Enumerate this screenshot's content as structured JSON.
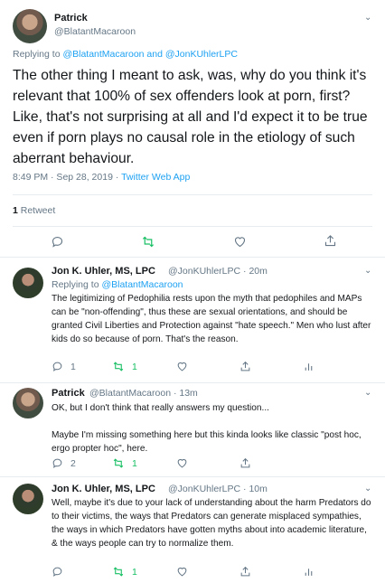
{
  "main_tweet": {
    "author_name": "Patrick",
    "author_handle": "@BlatantMacaroon",
    "reply_prefix": "Replying to ",
    "reply_handle_1": "@BlatantMacaroon",
    "reply_and": " and ",
    "reply_handle_2": "@JonKUhlerLPC",
    "text": "The other thing I meant to ask, was, why do you think it's relevant that 100% of sex offenders look at porn, first? Like, that's not surprising at all and I'd expect it to be true even if porn plays no causal role in the etiology of such aberrant behaviour.",
    "timestamp": "8:49 PM · Sep 28, 2019 · ",
    "source_app": "Twitter Web App",
    "retweet_count": "1",
    "retweet_label": " Retweet"
  },
  "replies": [
    {
      "author_name": "Jon K. Uhler, MS, LPC",
      "author_handle": "@JonKUhlerLPC · 20m",
      "reply_prefix": "Replying to ",
      "reply_handle": "@BlatantMacaroon",
      "text": "The legitimizing of Pedophilia rests upon the myth that pedophiles and MAPs can be \"non-offending\", thus these are sexual orientations, and should be granted Civil Liberties and Protection against \"hate speech.\" Men who lust after kids do so because of porn. That's the reason.",
      "reply_count": "1",
      "retweet_count": "1",
      "like_count": ""
    },
    {
      "author_name": "Patrick",
      "author_handle": "@BlatantMacaroon · 13m",
      "text": "OK, but I don't think that really answers my question...\n\nMaybe I'm missing something here but this kinda looks like classic \"post hoc, ergo propter hoc\", here.",
      "reply_count": "2",
      "retweet_count": "1",
      "like_count": ""
    },
    {
      "author_name": "Jon K. Uhler, MS, LPC",
      "author_handle": "@JonKUhlerLPC · 10m",
      "text": "Well, maybe it's due to your lack of understanding about the harm Predators do to their victims, the ways that Predators can generate misplaced sympathies, the ways in which Predators have gotten myths about into academic literature, & the ways people can try to normalize them.",
      "reply_count": "",
      "retweet_count": "1",
      "like_count": ""
    }
  ],
  "icons": {
    "more": "chevron-down-icon",
    "reply": "reply-icon",
    "retweet": "retweet-icon",
    "like": "heart-icon",
    "share": "share-icon",
    "analytics": "analytics-icon"
  },
  "colors": {
    "link": "#1da1f2",
    "secondary": "#657786",
    "retweet_active": "#17bf63",
    "divider": "#e6ecf0"
  }
}
